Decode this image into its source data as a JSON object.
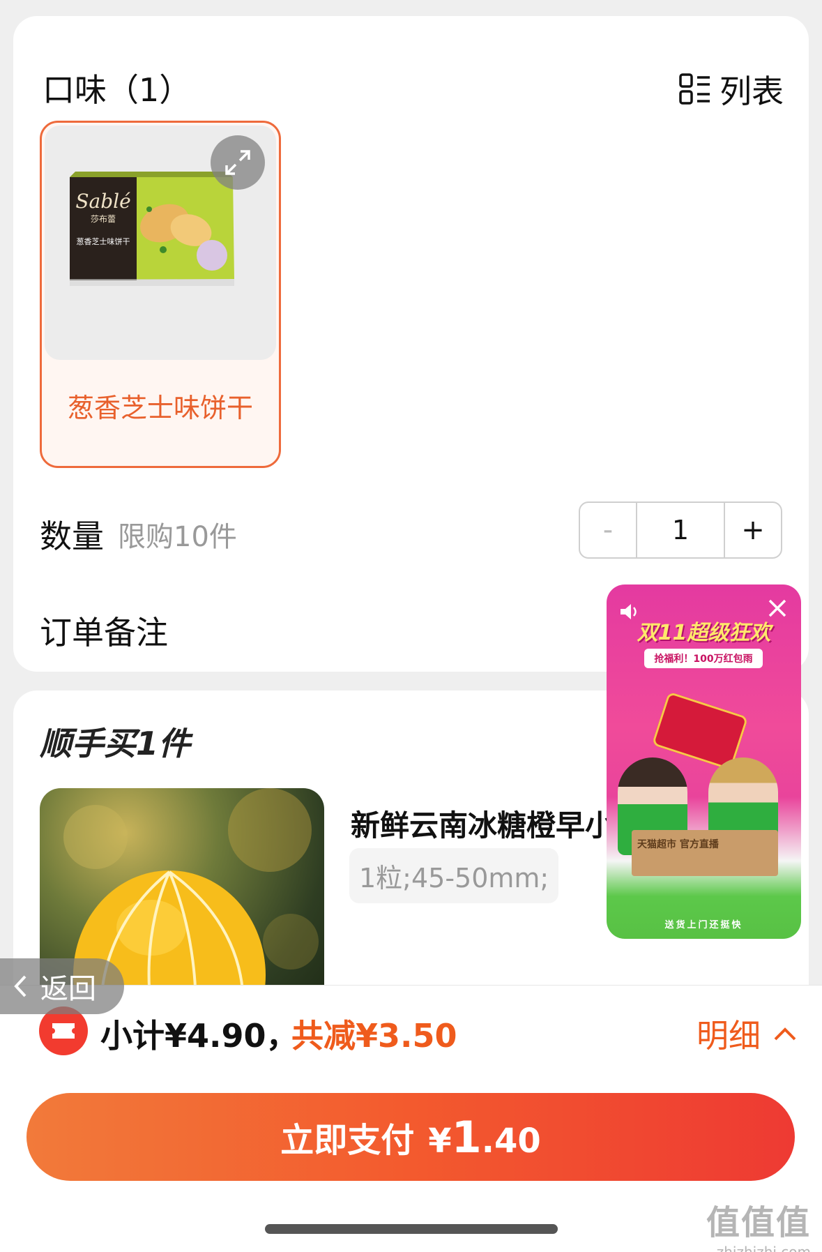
{
  "flavor_section": {
    "title": "口味（1）",
    "view_toggle_label": "列表",
    "options": [
      {
        "name": "葱香芝士味饼干",
        "selected": true,
        "package_brand": "Sablé",
        "package_brand_cn": "莎布蕾",
        "package_text": "葱香芝士味饼干"
      }
    ]
  },
  "quantity": {
    "label": "数量",
    "limit": "限购10件",
    "value": "1",
    "minus": "-",
    "plus": "+"
  },
  "order_note": {
    "label": "订单备注"
  },
  "addon": {
    "title": "顺手买1件",
    "product": {
      "name": "新鲜云南冰糖橙早小",
      "spec": "1粒;45-50mm;"
    }
  },
  "live_popup": {
    "headline": "双11超级狂欢",
    "banner": "抢福利！100万红包雨",
    "box_text": "天猫超市  官方直播",
    "slogan": "送货上门还挺快"
  },
  "back_button": {
    "label": "返回"
  },
  "summary": {
    "subtotal": "小计¥4.90，",
    "discount": "共减¥3.50",
    "detail": "明细"
  },
  "pay_button": {
    "label": "立即支付",
    "currency": "¥",
    "amount_int": "1",
    "amount_dec": ".40"
  },
  "watermark": {
    "big": "值值值",
    "small": "zhizhizhi.com"
  },
  "colors": {
    "accent": "#ef5b1c",
    "pay_start": "#f27a3a",
    "pay_end": "#ee3a33"
  }
}
